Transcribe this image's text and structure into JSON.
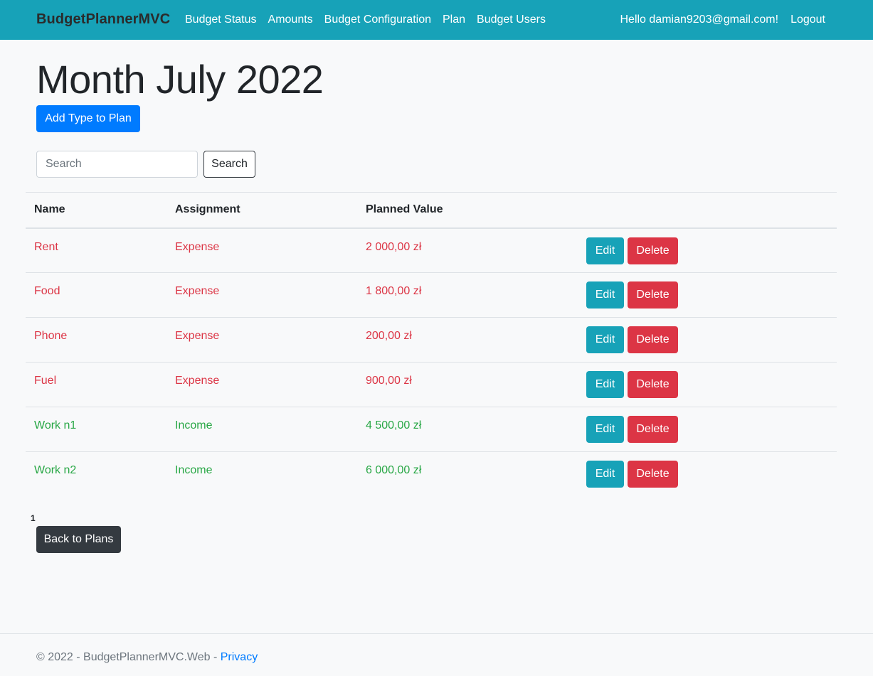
{
  "navbar": {
    "brand": "BudgetPlannerMVC",
    "links": [
      "Budget Status",
      "Amounts",
      "Budget Configuration",
      "Plan",
      "Budget Users"
    ],
    "greeting": "Hello damian9203@gmail.com!",
    "logout": "Logout",
    "bg_color": "#17a2b8"
  },
  "page": {
    "title": "Month July 2022",
    "add_button": "Add Type to Plan",
    "search_placeholder": "Search",
    "search_button": "Search",
    "back_button": "Back to Plans",
    "page_number": "1"
  },
  "table": {
    "headers": [
      "Name",
      "Assignment",
      "Planned Value"
    ],
    "edit_label": "Edit",
    "delete_label": "Delete",
    "rows": [
      {
        "name": "Rent",
        "assignment": "Expense",
        "value": "2 000,00 zł",
        "kind": "expense"
      },
      {
        "name": "Food",
        "assignment": "Expense",
        "value": "1 800,00 zł",
        "kind": "expense"
      },
      {
        "name": "Phone",
        "assignment": "Expense",
        "value": "200,00 zł",
        "kind": "expense"
      },
      {
        "name": "Fuel",
        "assignment": "Expense",
        "value": "900,00 zł",
        "kind": "expense"
      },
      {
        "name": "Work n1",
        "assignment": "Income",
        "value": "4 500,00 zł",
        "kind": "income"
      },
      {
        "name": "Work n2",
        "assignment": "Income",
        "value": "6 000,00 zł",
        "kind": "income"
      }
    ]
  },
  "footer": {
    "text": "© 2022 - BudgetPlannerMVC.Web - ",
    "privacy": "Privacy"
  },
  "colors": {
    "expense": "#dc3545",
    "income": "#28a745",
    "primary": "#007bff",
    "info": "#17a2b8",
    "dark": "#343a40"
  }
}
